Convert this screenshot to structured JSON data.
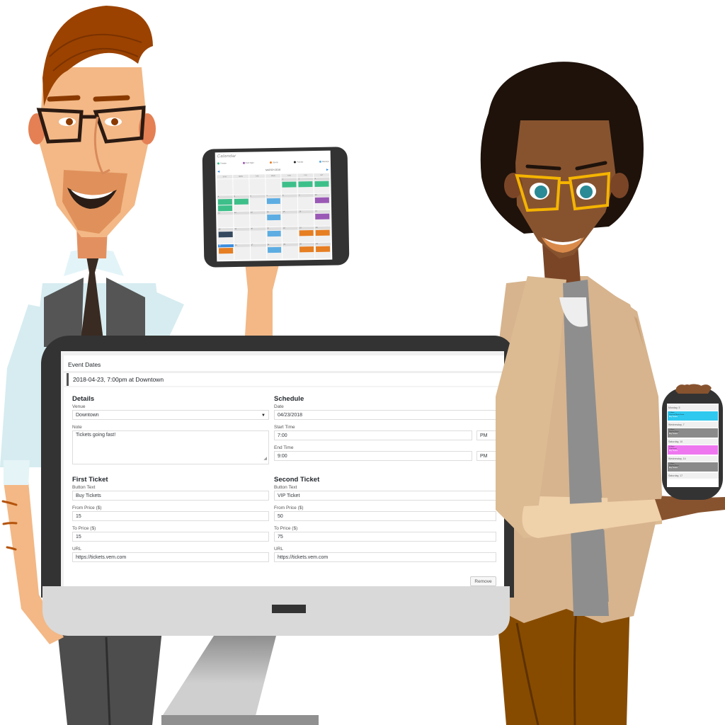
{
  "colors": {
    "accent_blue": "#3c8dde",
    "event_green": "#3dbf8a",
    "event_purple": "#9b59b6",
    "event_orange": "#e67e22",
    "event_navy": "#34495e",
    "event_lightblue": "#5dade2",
    "phone_cyan": "#2fc8ee",
    "phone_gray": "#8a8a8a",
    "phone_pink": "#ee77f0"
  },
  "monitor": {
    "panel_title": "Event Dates",
    "event_header": "2018-04-23, 7:00pm at Downtown",
    "details": {
      "title": "Details",
      "venue_label": "Venue",
      "venue_value": "Downtown",
      "note_label": "Note",
      "note_value": "Tickets going fast!"
    },
    "schedule": {
      "title": "Schedule",
      "date_label": "Date",
      "date_value": "04/23/2018",
      "start_label": "Start Time",
      "start_value": "7:00",
      "start_ampm": "PM",
      "end_label": "End Time",
      "end_value": "9:00",
      "end_ampm": "PM"
    },
    "first_ticket": {
      "title": "First Ticket",
      "button_text_label": "Button Text",
      "button_text_value": "Buy Tickets",
      "from_price_label": "From Price ($)",
      "from_price_value": "15",
      "to_price_label": "To Price ($)",
      "to_price_value": "15",
      "url_label": "URL",
      "url_value": "https://tickets.vem.com"
    },
    "second_ticket": {
      "title": "Second Ticket",
      "button_text_label": "Button Text",
      "button_text_value": "VIP Ticket",
      "from_price_label": "From Price ($)",
      "from_price_value": "50",
      "to_price_label": "To Price ($)",
      "to_price_value": "75",
      "url_label": "URL",
      "url_value": "https://tickets.vem.com"
    },
    "remove_label": "Remove"
  },
  "tablet": {
    "title": "Calendar",
    "legend": [
      {
        "label": "Theater",
        "color": "#3dbf8a"
      },
      {
        "label": "Club Night",
        "color": "#9b59b6"
      },
      {
        "label": "Sports",
        "color": "#e67e22"
      },
      {
        "label": "Popular",
        "color": "#222222"
      },
      {
        "label": "Meetups",
        "color": "#5dade2"
      }
    ],
    "month": "MARCH 2018",
    "nav_prev": "◀",
    "nav_next": "▶",
    "weekdays": [
      "SUN",
      "MON",
      "TUE",
      "WED",
      "THU",
      "FRI",
      "SAT"
    ],
    "weeks": [
      [
        {
          "d": ""
        },
        {
          "d": ""
        },
        {
          "d": ""
        },
        {
          "d": ""
        },
        {
          "d": "1",
          "ev": [
            "green"
          ]
        },
        {
          "d": "2",
          "ev": [
            "green"
          ]
        },
        {
          "d": "3",
          "ev": [
            "green"
          ]
        }
      ],
      [
        {
          "d": "4",
          "ev": [
            "green",
            "green"
          ]
        },
        {
          "d": "5",
          "ev": [
            "green"
          ]
        },
        {
          "d": "6"
        },
        {
          "d": "7",
          "ev": [
            "lightblue"
          ]
        },
        {
          "d": "8"
        },
        {
          "d": "9"
        },
        {
          "d": "10",
          "ev": [
            "purple"
          ]
        }
      ],
      [
        {
          "d": "11"
        },
        {
          "d": "12"
        },
        {
          "d": "13"
        },
        {
          "d": "14",
          "ev": [
            "lightblue"
          ]
        },
        {
          "d": "15"
        },
        {
          "d": "16"
        },
        {
          "d": "17",
          "ev": [
            "purple"
          ]
        }
      ],
      [
        {
          "d": "18",
          "ev": [
            "navy"
          ]
        },
        {
          "d": "19"
        },
        {
          "d": "20"
        },
        {
          "d": "21",
          "ev": [
            "lightblue"
          ]
        },
        {
          "d": "22"
        },
        {
          "d": "23",
          "ev": [
            "orange"
          ]
        },
        {
          "d": "24",
          "ev": [
            "orange"
          ]
        }
      ],
      [
        {
          "d": "25",
          "ev": [
            "orange"
          ],
          "today": true
        },
        {
          "d": "26"
        },
        {
          "d": "27"
        },
        {
          "d": "28",
          "ev": [
            "lightblue"
          ]
        },
        {
          "d": "29"
        },
        {
          "d": "30",
          "ev": [
            "orange"
          ]
        },
        {
          "d": "31",
          "ev": [
            "orange"
          ]
        }
      ]
    ]
  },
  "phone": {
    "days": [
      {
        "label": "Monday, 5",
        "event": {
          "time": "7:30pm",
          "name": "Classical Music Event",
          "cta": "Buy Tickets",
          "color": "#2fc8ee"
        }
      },
      {
        "label": "Wednesday, 7",
        "event": {
          "time": "7:30pm",
          "name": "Meetup Event",
          "cta": "Buy Tickets",
          "color": "#8a8a8a"
        }
      },
      {
        "label": "Saturday, 10",
        "event": {
          "time": "8:30pm",
          "name": "Club Event",
          "cta": "Buy Tickets",
          "color": "#ee77f0"
        }
      },
      {
        "label": "Wednesday, 14",
        "event": {
          "time": "7:30pm",
          "name": "Meetup Event",
          "cta": "Buy Tickets",
          "color": "#8a8a8a"
        }
      },
      {
        "label": "Saturday, 17",
        "event": null
      }
    ]
  }
}
